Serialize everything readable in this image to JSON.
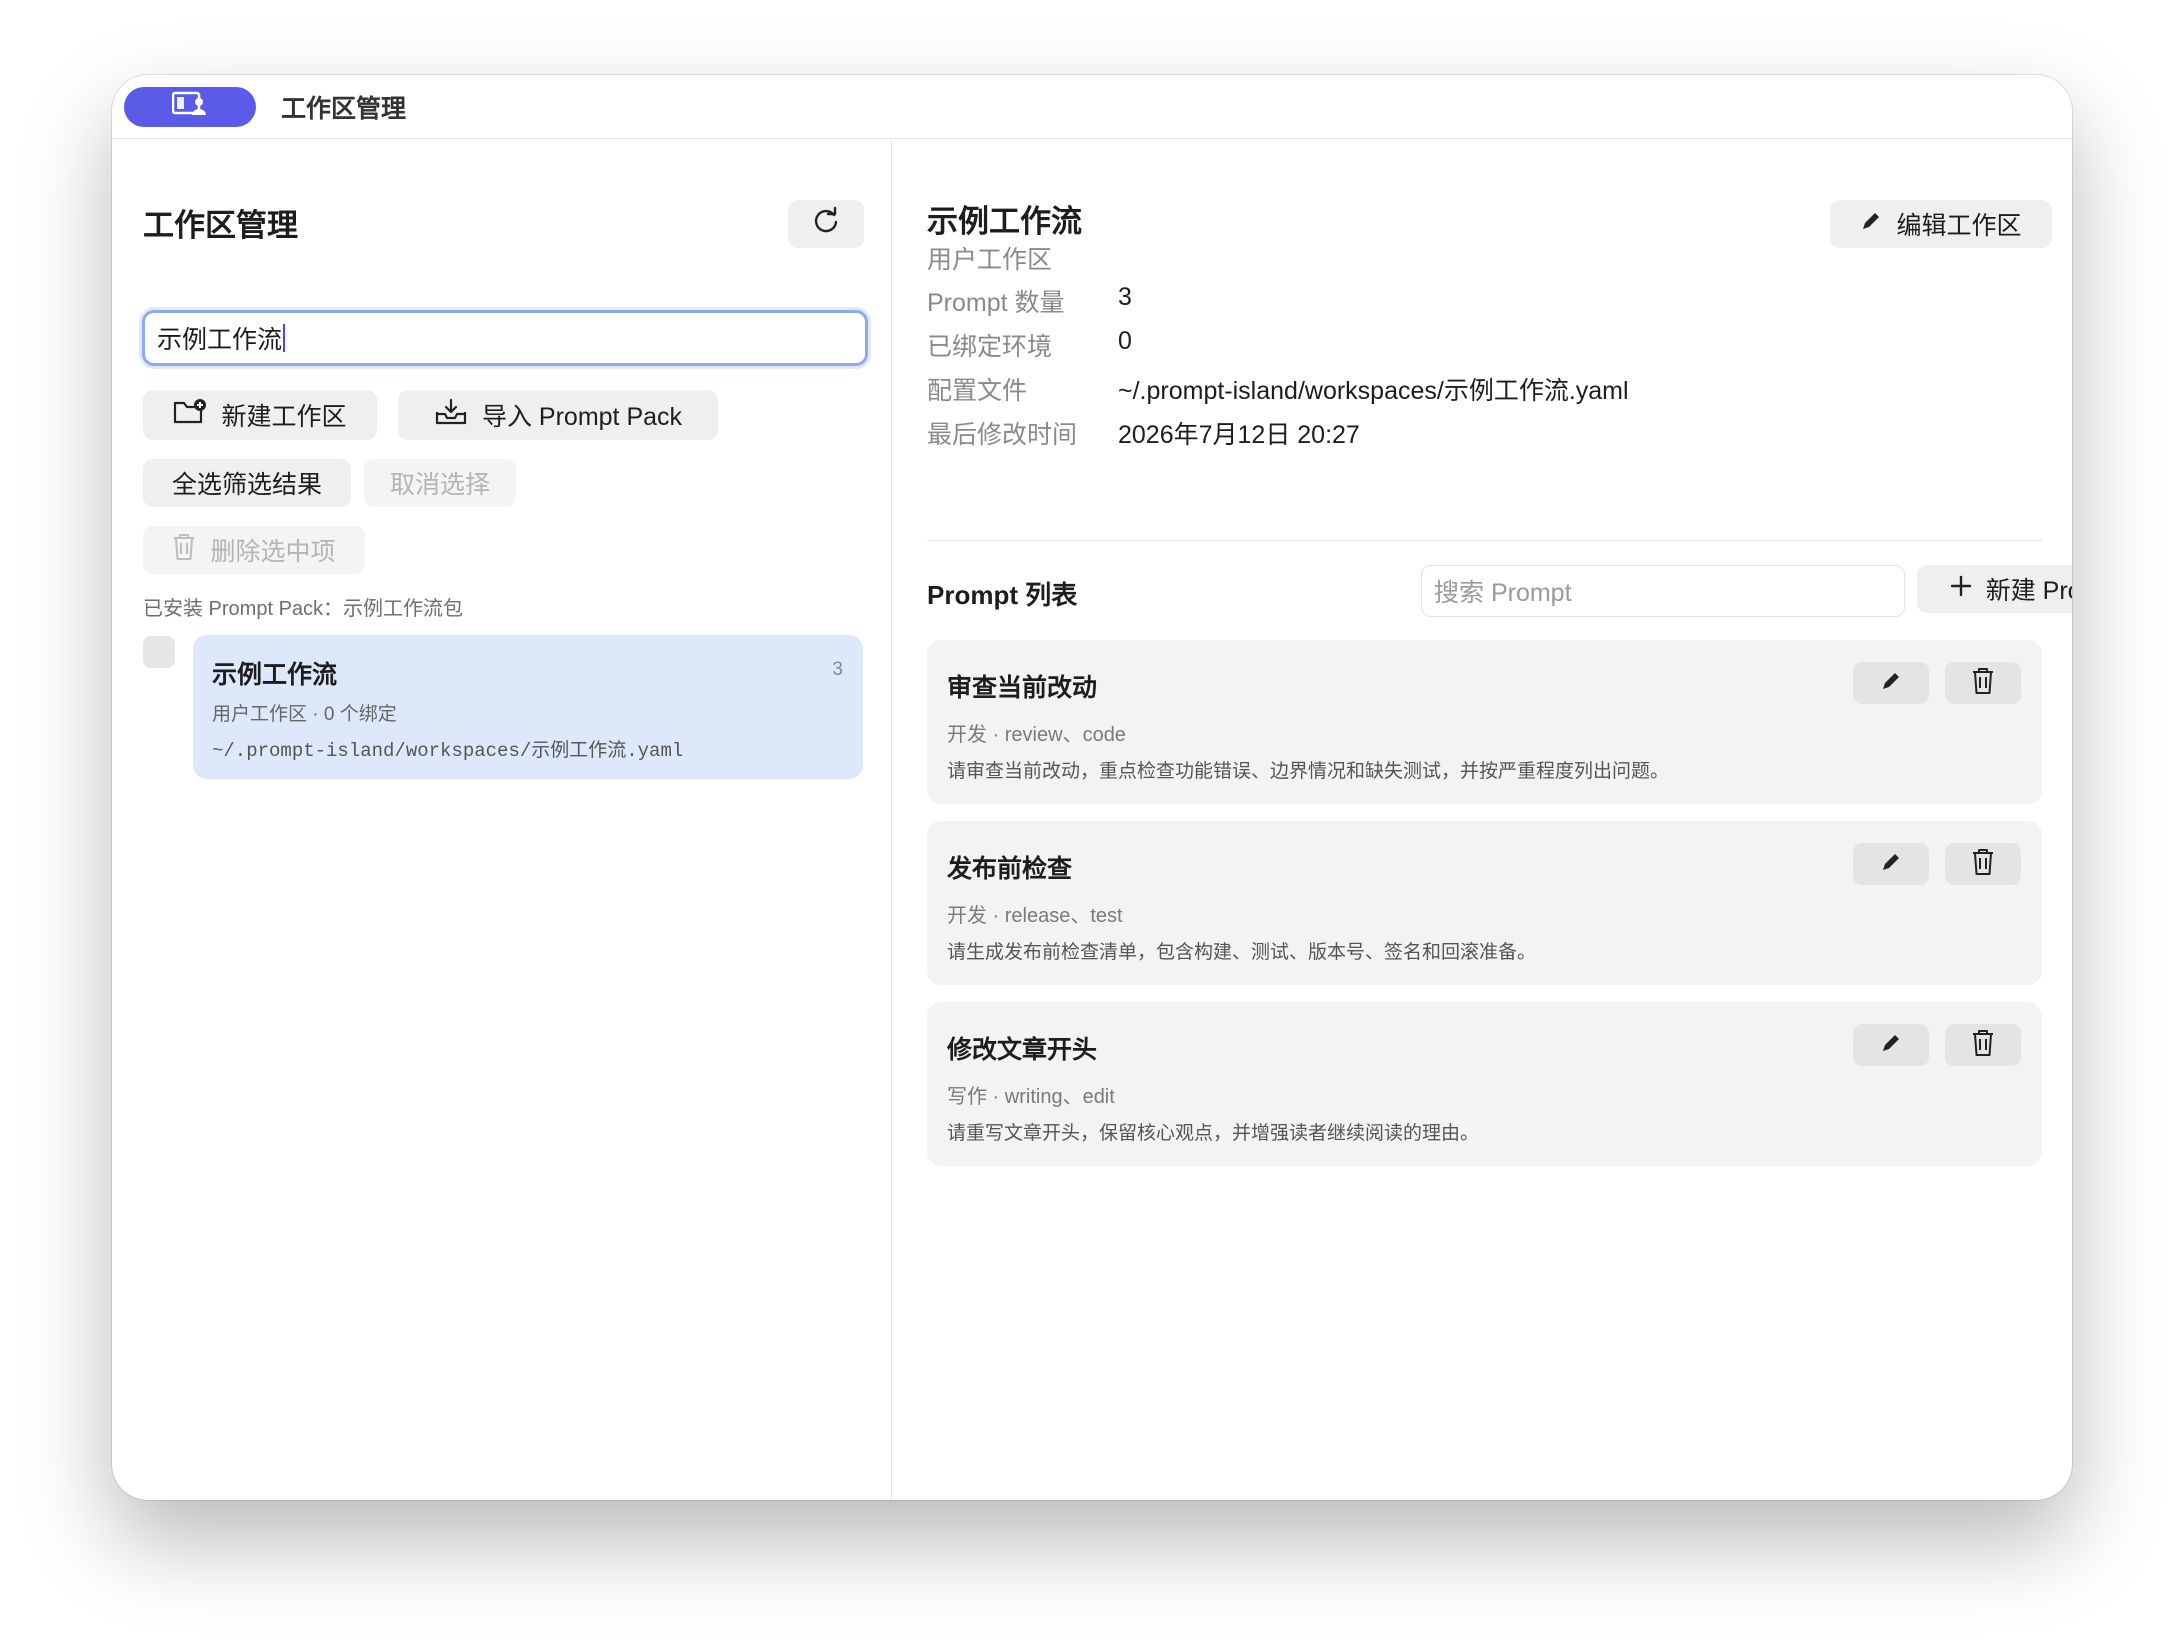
{
  "window": {
    "title": "工作区管理",
    "accent": "#5b5bea"
  },
  "left": {
    "heading": "工作区管理",
    "search_value": "示例工作流",
    "new_workspace_label": "新建工作区",
    "import_pack_label": "导入 Prompt Pack",
    "select_all_label": "全选筛选结果",
    "deselect_label": "取消选择",
    "delete_selected_label": "删除选中项",
    "installed_pack_text": "已安装 Prompt Pack：示例工作流包",
    "workspaces": [
      {
        "name": "示例工作流",
        "count": "3",
        "subtitle": "用户工作区 · 0 个绑定",
        "path": "~/.prompt-island/workspaces/示例工作流.yaml"
      }
    ]
  },
  "detail": {
    "title": "示例工作流",
    "subtitle": "用户工作区",
    "edit_label": "编辑工作区",
    "meta": [
      {
        "key": "Prompt 数量",
        "value": "3"
      },
      {
        "key": "已绑定环境",
        "value": "0"
      },
      {
        "key": "配置文件",
        "value": "~/.prompt-island/workspaces/示例工作流.yaml"
      },
      {
        "key": "最后修改时间",
        "value": "2026年7月12日 20:27"
      }
    ],
    "prompt_list_heading": "Prompt 列表",
    "prompt_search_placeholder": "搜索 Prompt",
    "new_prompt_label": "新建 Prompt",
    "prompts": [
      {
        "title": "审查当前改动",
        "tags": "开发 · review、code",
        "description": "请审查当前改动，重点检查功能错误、边界情况和缺失测试，并按严重程度列出问题。"
      },
      {
        "title": "发布前检查",
        "tags": "开发 · release、test",
        "description": "请生成发布前检查清单，包含构建、测试、版本号、签名和回滚准备。"
      },
      {
        "title": "修改文章开头",
        "tags": "写作 · writing、edit",
        "description": "请重写文章开头，保留核心观点，并增强读者继续阅读的理由。"
      }
    ]
  }
}
